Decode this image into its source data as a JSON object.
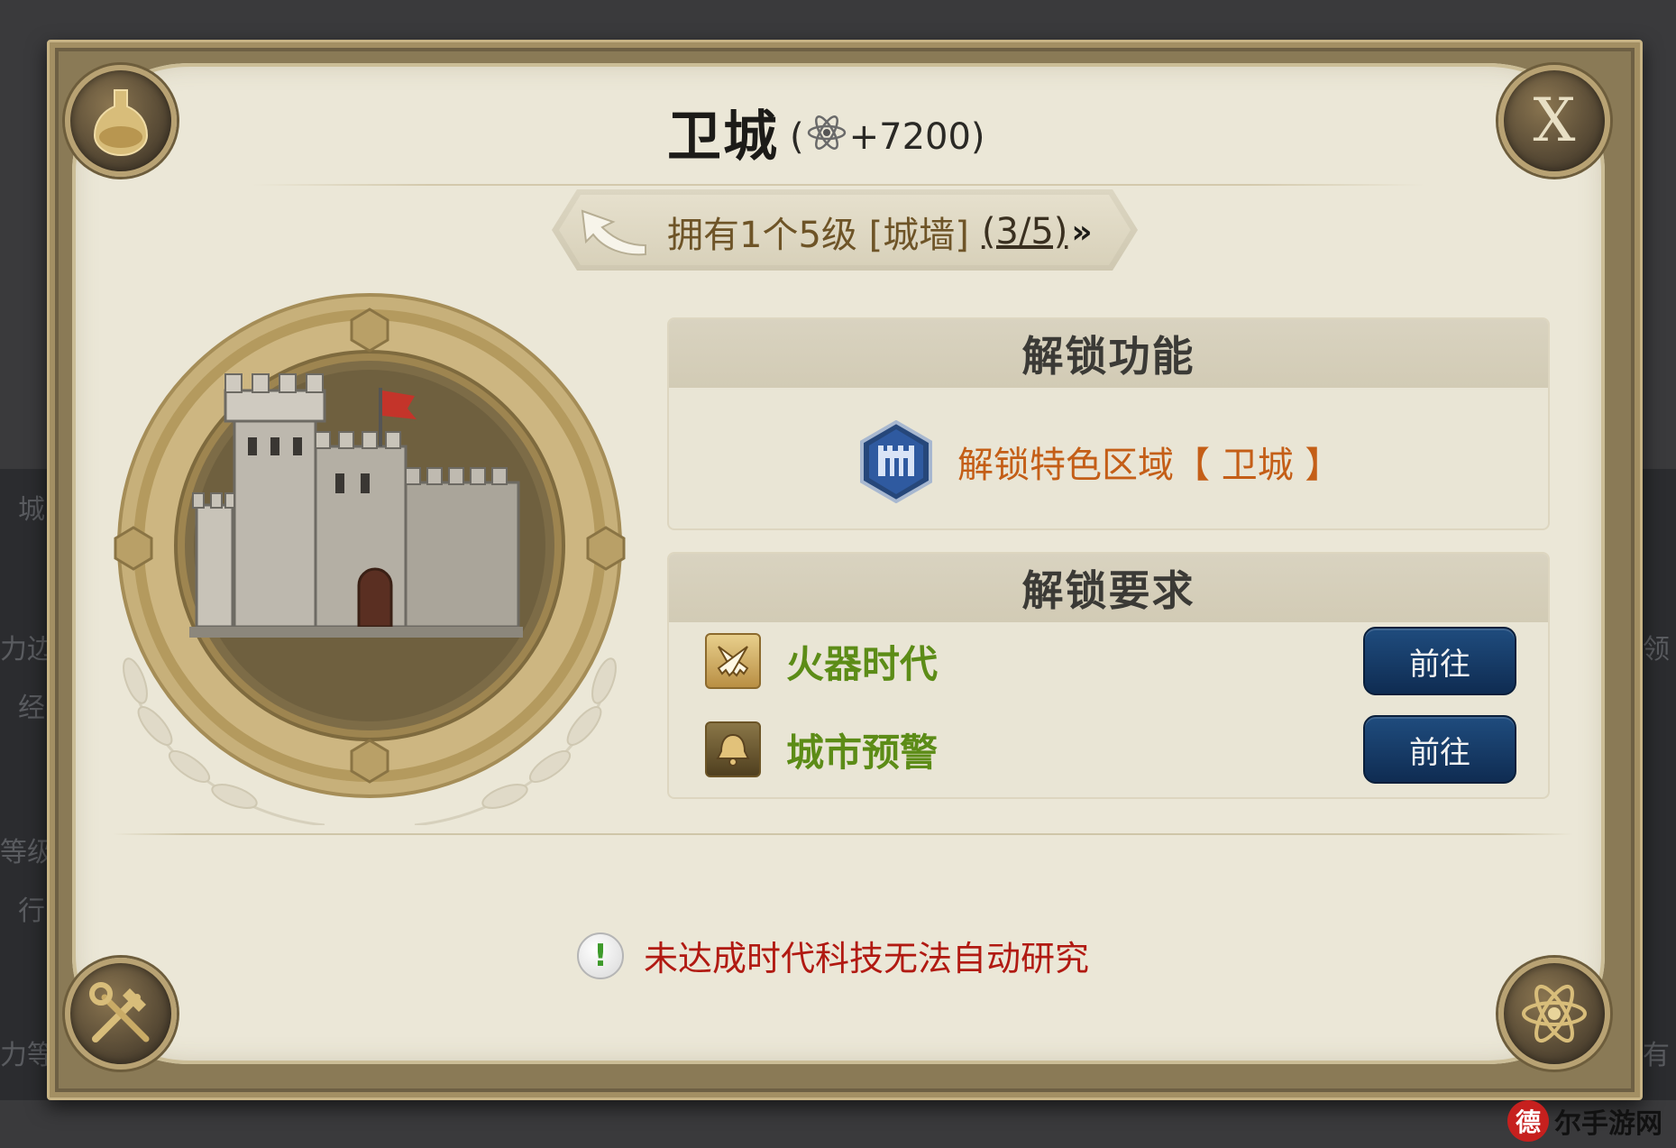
{
  "dialog": {
    "title": "卫城",
    "bonus_open": "(",
    "bonus_value": "+7200",
    "bonus_close": ")",
    "close_label": "X"
  },
  "requirement_banner": {
    "text": "拥有1个5级 [城墙]",
    "progress": "(3/5)",
    "chevron": "»"
  },
  "unlock_function": {
    "heading": "解锁功能",
    "feature_text": "解锁特色区域【 卫城 】"
  },
  "unlock_requirements": {
    "heading": "解锁要求",
    "items": [
      {
        "label": "火器时代",
        "button": "前往"
      },
      {
        "label": "城市预警",
        "button": "前往"
      }
    ]
  },
  "warning": {
    "icon": "!",
    "text": "未达成时代科技无法自动研究"
  },
  "background_fragments": [
    "城",
    "力边",
    "经",
    "等级",
    "行",
    "力等",
    "领",
    "有"
  ],
  "watermark": {
    "logo": "德",
    "text": "尔手游网"
  },
  "colors": {
    "feature_orange": "#c45e17",
    "requirement_green": "#5c8c17",
    "warning_red": "#b11a12",
    "button_blue": "#1f4c7e"
  }
}
